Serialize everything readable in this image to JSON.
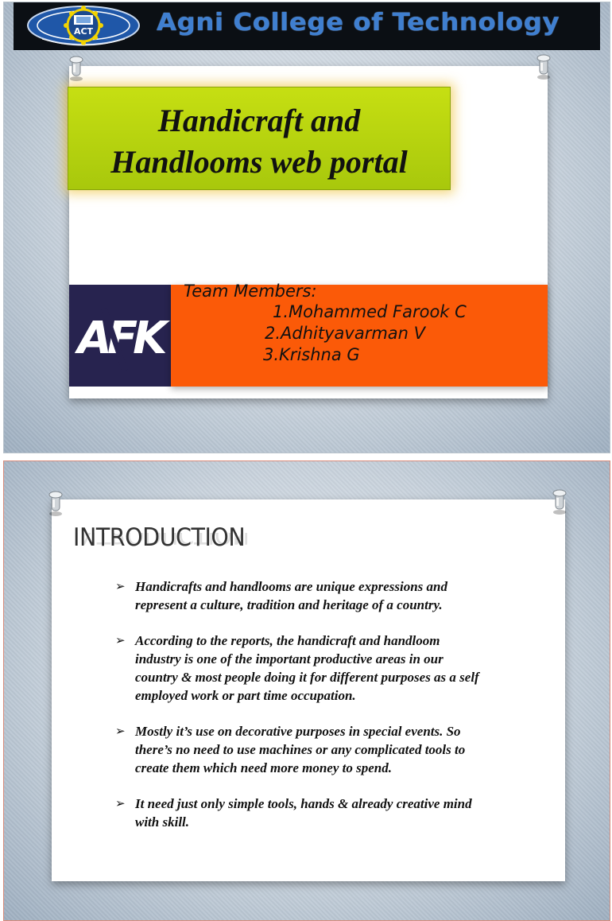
{
  "slide1": {
    "college_name": "Agni College of Technology",
    "logo_text": "ACT",
    "title_lines": [
      "Handicraft and",
      "Handlooms web portal"
    ],
    "team_heading": "Team Members:",
    "members": [
      "1.Mohammed Farook  C",
      "2.Adhityavarman  V",
      "3.Krishna G"
    ],
    "afk_logo_text": "AFK"
  },
  "slide2": {
    "heading": "INTRODUCTION",
    "bullet_marker": "➢",
    "bullets": [
      {
        "lines": [
          "Handicrafts and handlooms are unique expressions and",
          "represent a culture, tradition and heritage of a country."
        ]
      },
      {
        "lines": [
          "According to the reports, the handicraft and handloom",
          "industry is one of the important productive areas in our",
          "country & most people doing it for different purposes as a self",
          "employed work or part time occupation."
        ]
      },
      {
        "lines": [
          "Mostly it’s use on decorative purposes in special events. So",
          "there’s no need to use machines or any complicated tools to",
          "create them which need more money to spend."
        ]
      },
      {
        "lines": [
          "It need just only simple tools, hands & already creative mind",
          "with skill."
        ]
      }
    ]
  },
  "colors": {
    "title_box": "#b5d20e",
    "team_box": "#fb5a08",
    "afk_box": "#27234f",
    "header_bar": "#0b0f14",
    "college_name": "#3f7fd0"
  }
}
